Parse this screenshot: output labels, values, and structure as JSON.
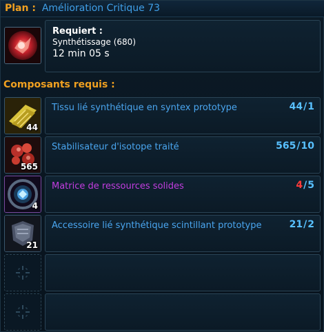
{
  "title": {
    "prefix": "Plan :",
    "name": "Amélioration Critique 73"
  },
  "requirement": {
    "label": "Requiert :",
    "skill": "Synthétissage (680)",
    "time": "12 min 05 s"
  },
  "components_header": "Composants requis :",
  "components": [
    {
      "name": "Tissu lié synthétique en syntex prototype",
      "have": "44",
      "need": "1",
      "count": "44",
      "color": "#4aa6f0",
      "icon": "gold-fabric-icon"
    },
    {
      "name": "Stabilisateur d'isotope traité",
      "have": "565",
      "need": "10",
      "count": "565",
      "color": "#4aa6f0",
      "icon": "red-crystals-icon"
    },
    {
      "name": "Matrice de ressources solides",
      "have": "4",
      "need": "5",
      "count": "4",
      "color": "#c23de0",
      "icon": "purple-matrix-icon",
      "insufficient": true
    },
    {
      "name": "Accessoire lié synthétique scintillant prototype",
      "have": "21",
      "need": "2",
      "count": "21",
      "color": "#4aa6f0",
      "icon": "metal-armor-icon"
    }
  ],
  "empty_slots": 2,
  "colors": {
    "accent_orange": "#f0a020",
    "title_blue": "#3f9fe8",
    "quantity_blue": "#58c0ff",
    "insufficient_red": "#ff3a3a"
  }
}
